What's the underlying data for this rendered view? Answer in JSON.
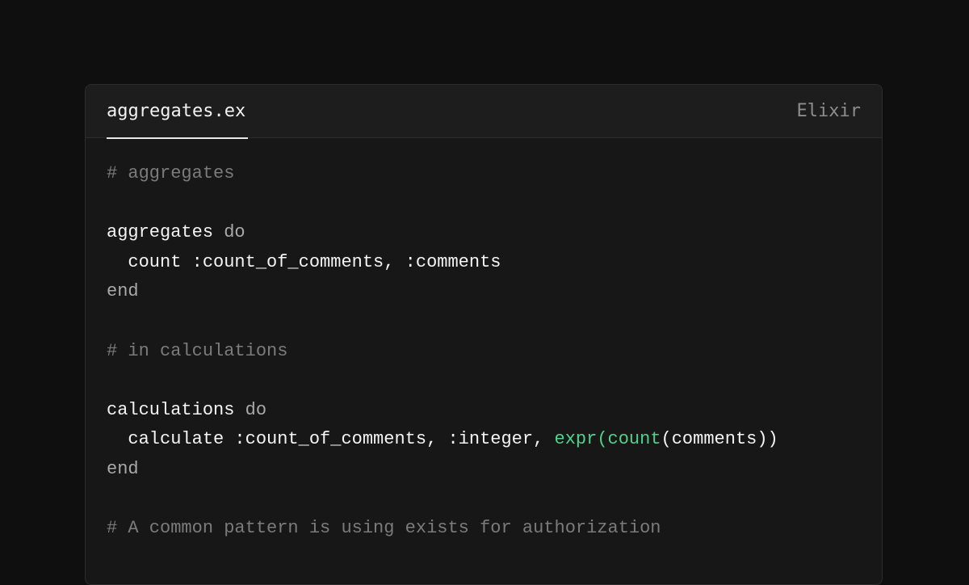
{
  "editor": {
    "filename": "aggregates.ex",
    "language": "Elixir",
    "colors": {
      "background": "#0f0f0f",
      "panel": "#171717",
      "comment": "#7b7b7b",
      "keyword": "#a9a9a9",
      "text": "#f4f4f4",
      "function": "#4fd38c"
    }
  },
  "code": {
    "line1": {
      "comment": "# aggregates"
    },
    "line3": {
      "text": "aggregates",
      "keyword": " do"
    },
    "line4": {
      "text": "  count :count_of_comments, :comments"
    },
    "line5": {
      "keyword": "end"
    },
    "line7": {
      "comment": "# in calculations"
    },
    "line9": {
      "text": "calculations",
      "keyword": " do"
    },
    "line10": {
      "text_a": "  calculate :count_of_comments, :integer, ",
      "fn_expr": "expr",
      "paren_open_1": "(",
      "fn_count": "count",
      "text_b": "(comments))"
    },
    "line11": {
      "keyword": "end"
    },
    "line13": {
      "comment": "# A common pattern is using exists for authorization"
    }
  }
}
